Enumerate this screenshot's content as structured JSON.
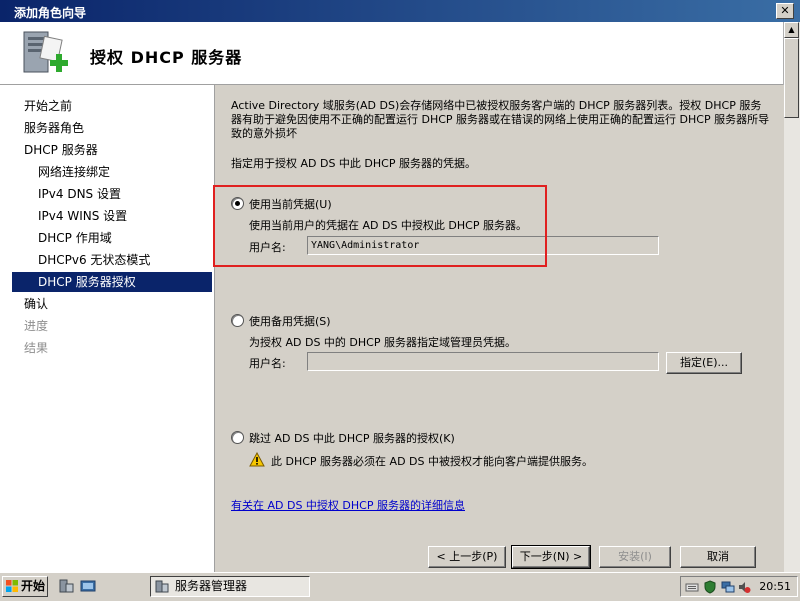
{
  "window": {
    "title": "添加角色向导",
    "close_label": "✕"
  },
  "header": {
    "title": "授权 DHCP 服务器"
  },
  "nav": {
    "items": [
      {
        "label": "开始之前"
      },
      {
        "label": "服务器角色"
      },
      {
        "label": "DHCP 服务器"
      },
      {
        "label": "网络连接绑定"
      },
      {
        "label": "IPv4 DNS 设置"
      },
      {
        "label": "IPv4 WINS 设置"
      },
      {
        "label": "DHCP 作用域"
      },
      {
        "label": "DHCPv6 无状态模式"
      },
      {
        "label": "DHCP 服务器授权"
      },
      {
        "label": "确认"
      },
      {
        "label": "进度"
      },
      {
        "label": "结果"
      }
    ]
  },
  "content": {
    "intro": "Active Directory 域服务(AD DS)会存储网络中已被授权服务客户端的 DHCP 服务器列表。授权 DHCP 服务器有助于避免因使用不正确的配置运行 DHCP 服务器或在错误的网络上使用正确的配置运行 DHCP 服务器所导致的意外损坏",
    "specify": "指定用于授权 AD DS 中此 DHCP 服务器的凭据。",
    "option_current": {
      "label": "使用当前凭据(U)",
      "desc": "使用当前用户的凭据在 AD DS 中授权此 DHCP 服务器。",
      "user_label": "用户名:",
      "user_value": "YANG\\Administrator",
      "selected": true
    },
    "option_alternate": {
      "label": "使用备用凭据(S)",
      "desc": "为授权 AD DS 中的 DHCP 服务器指定域管理员凭据。",
      "user_label": "用户名:",
      "user_value": "",
      "specify_button": "指定(E)...",
      "selected": false
    },
    "option_skip": {
      "label": "跳过 AD DS 中此 DHCP 服务器的授权(K)",
      "warning": "此 DHCP 服务器必须在 AD DS 中被授权才能向客户端提供服务。",
      "selected": false
    },
    "more_info_link": "有关在 AD DS 中授权 DHCP 服务器的详细信息"
  },
  "buttons": {
    "back": "< 上一步(P)",
    "next": "下一步(N) >",
    "install": "安装(I)",
    "cancel": "取消"
  },
  "taskbar": {
    "start_label": "开始",
    "task_label": "服务器管理器",
    "clock": "20:51"
  },
  "colors": {
    "accent": "#0a246a",
    "highlight_box": "#e02020",
    "link": "#0000cc"
  }
}
